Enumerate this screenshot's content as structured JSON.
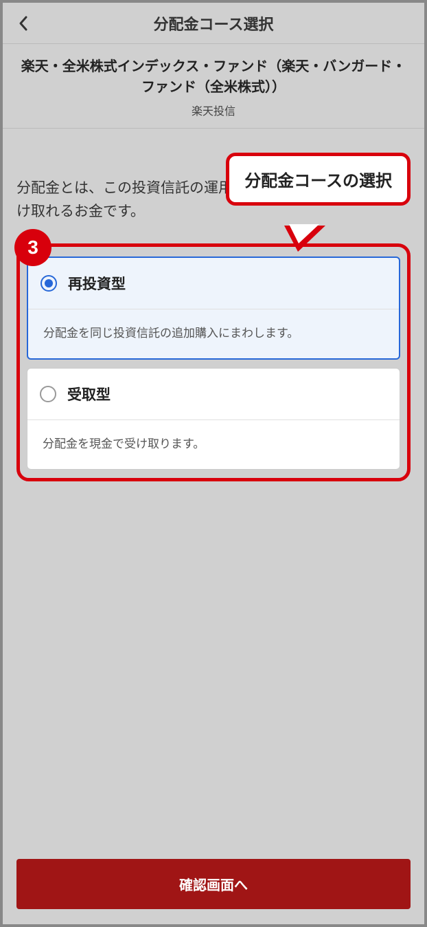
{
  "header": {
    "title": "分配金コース選択"
  },
  "fund": {
    "name": "楽天・全米株式インデックス・ファンド（楽天・バンガード・ファンド（全米株式））",
    "company": "楽天投信"
  },
  "description": "分配金とは、この投資信託の運用益から定期的にあなたが受け取れるお金です。",
  "callout": {
    "text": "分配金コースの選択"
  },
  "step": {
    "number": "3"
  },
  "options": [
    {
      "title": "再投資型",
      "desc": "分配金を同じ投資信託の追加購入にまわします。",
      "selected": true
    },
    {
      "title": "受取型",
      "desc": "分配金を現金で受け取ります。",
      "selected": false
    }
  ],
  "footer": {
    "confirm_label": "確認画面へ"
  }
}
